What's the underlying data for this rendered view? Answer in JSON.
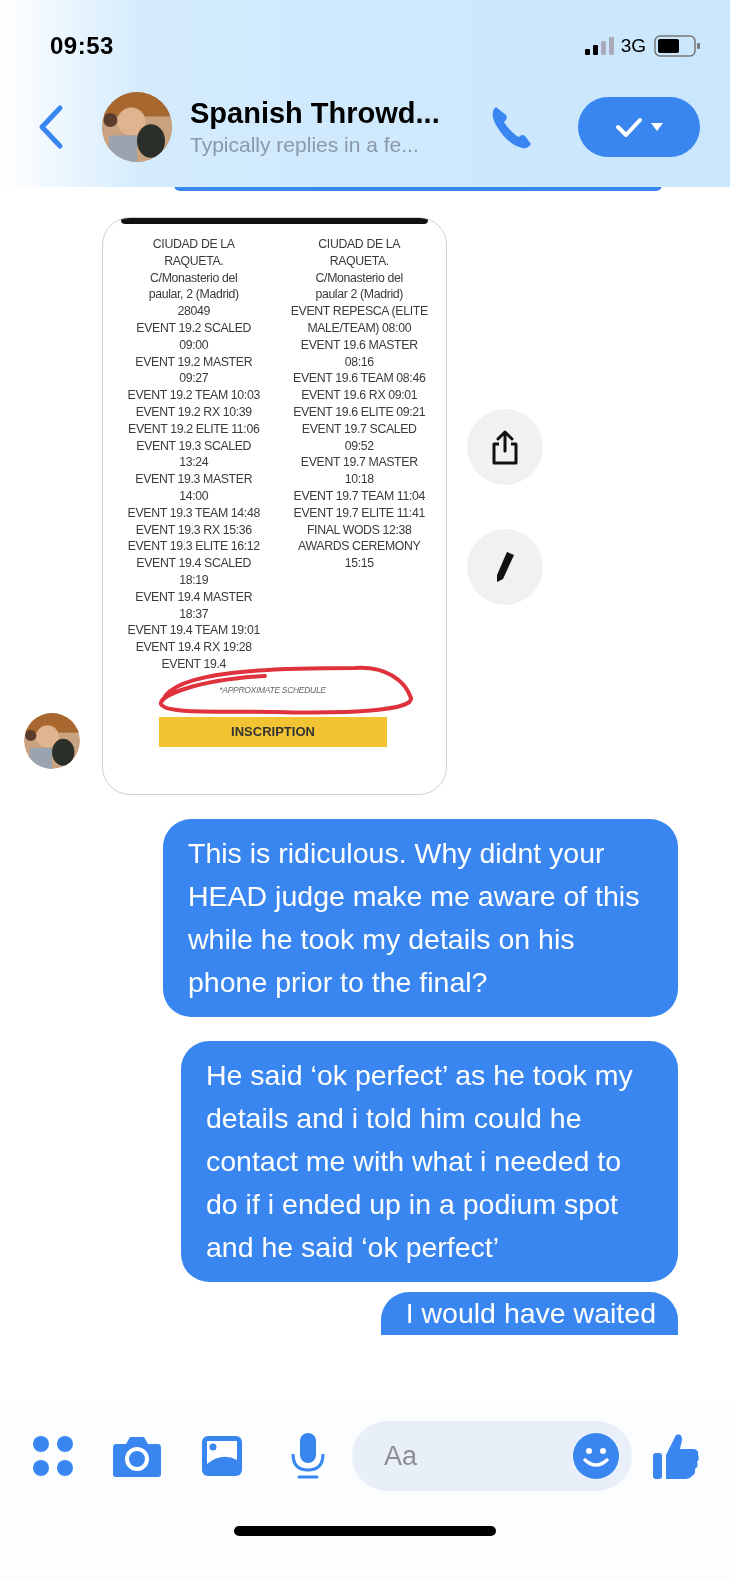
{
  "status_bar": {
    "time": "09:53",
    "network": "3G"
  },
  "header": {
    "title": "Spanish Throwd...",
    "subtitle": "Typically replies in a fe..."
  },
  "messages": [
    {
      "kind": "image",
      "outgoing": false,
      "schedule": {
        "columns": [
          [
            "CIUDAD DE LA",
            "RAQUETA.",
            "C/Monasterio del",
            "paular, 2 (Madrid)",
            "28049",
            "EVENT 19.2 SCALED",
            "09:00",
            "EVENT 19.2 MASTER",
            "09:27",
            "EVENT 19.2 TEAM 10:03",
            "EVENT 19.2 RX 10:39",
            "EVENT 19.2 ELITE 11:06",
            "EVENT 19.3 SCALED",
            "13:24",
            "EVENT 19.3 MASTER",
            "14:00",
            "EVENT 19.3 TEAM 14:48",
            "EVENT 19.3 RX 15:36",
            "EVENT 19.3 ELITE 16:12",
            "EVENT 19.4 SCALED",
            "18:19",
            "EVENT 19.4 MASTER",
            "18:37",
            "EVENT 19.4 TEAM 19:01",
            "EVENT 19.4 RX 19:28",
            "EVENT 19.4"
          ],
          [
            "CIUDAD DE LA",
            "RAQUETA.",
            "C/Monasterio del",
            "paular 2 (Madrid)",
            "EVENT REPESCA (ELITE",
            "MALE/TEAM) 08:00",
            "EVENT 19.6 MASTER",
            "08:16",
            "EVENT 19.6 TEAM 08:46",
            "EVENT 19.6 RX 09:01",
            "EVENT 19.6 ELITE 09:21",
            "EVENT 19.7 SCALED",
            "09:52",
            "EVENT 19.7 MASTER",
            "10:18",
            "EVENT 19.7 TEAM 11:04",
            "EVENT 19.7 ELITE 11:41",
            "FINAL WODS 12:38",
            "AWARDS CEREMONY",
            "15:15"
          ]
        ],
        "note": "*APPROXIMATE SCHEDULE",
        "button": "INSCRIPTION"
      }
    },
    {
      "kind": "text",
      "outgoing": true,
      "text": "This is ridiculous. Why didnt your HEAD judge make me aware of this while he took my details on his phone prior to the final?"
    },
    {
      "kind": "text",
      "outgoing": true,
      "text": "He said ‘ok perfect’ as he took my details and i told him could he contact me with what i needed to do if i ended up in a podium spot and he said ‘ok perfect’"
    },
    {
      "kind": "text",
      "outgoing": true,
      "text": "I would have waited"
    }
  ],
  "composer": {
    "placeholder": "Aa"
  }
}
